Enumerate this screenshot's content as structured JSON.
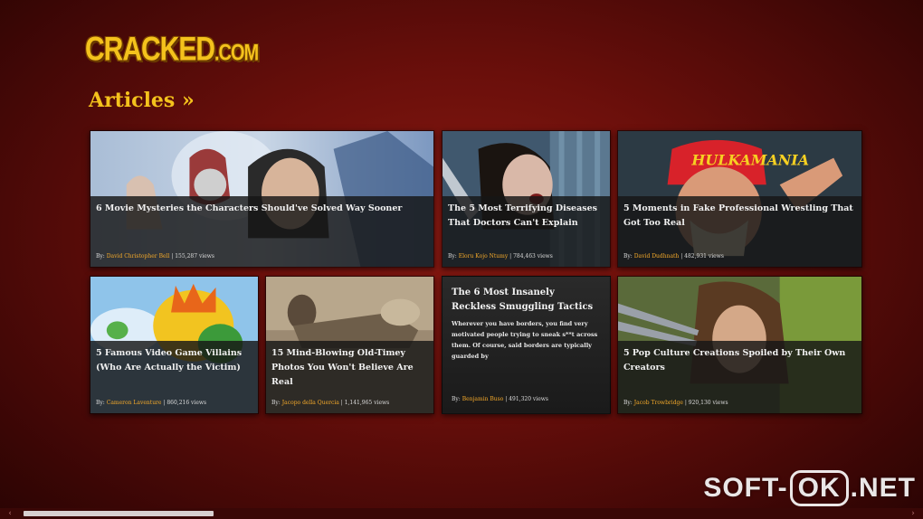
{
  "brand": {
    "logo_main": "CRACKED",
    "logo_domain": ".COM"
  },
  "section": {
    "title": "Articles »"
  },
  "articles": [
    {
      "title": "6 Movie Mysteries the Characters Should've Solved Way Sooner",
      "author": "David Christopher Bell",
      "views": "155,287 views",
      "by": "By:"
    },
    {
      "title": "The 5 Most Terrifying Diseases That Doctors Can't Explain",
      "author": "Eloru Kojo Ntumy",
      "views": "784,463 views",
      "by": "By:"
    },
    {
      "title": "5 Moments in Fake Professional Wrestling That Got Too Real",
      "author": "David Dudhnath",
      "views": "482,931 views",
      "by": "By:",
      "image_text": "HULKAMANIA"
    },
    {
      "title": "5 Famous Video Game Villains (Who Are Actually the Victim)",
      "author": "Cameron Laventure",
      "views": "860,216 views",
      "by": "By:"
    },
    {
      "title": "15 Mind-Blowing Old-Timey Photos You Won't Believe Are Real",
      "author": "Jacopo della Quercia",
      "views": "1,141,965 views",
      "by": "By:"
    },
    {
      "title": "The 6 Most Insanely Reckless Smuggling Tactics",
      "blurb": "Wherever you have borders, you find very motivated people trying to sneak s**t across them. Of course, said borders are typically guarded by",
      "author": "Benjamin Buso",
      "views": "491,320 views",
      "by": "By:"
    },
    {
      "title": "5 Pop Culture Creations Spoiled by Their Own Creators",
      "author": "Jacob Trowbridge",
      "views": "920,130 views",
      "by": "By:"
    }
  ],
  "scrollbar": {
    "left_arrow": "‹",
    "right_arrow": "›"
  },
  "watermark": {
    "left": "SOFT-",
    "ok": "OK",
    "right": ".NET"
  },
  "colors": {
    "accent": "#f4c21c",
    "author": "#f4a92a",
    "background": "#6a0f0b"
  }
}
